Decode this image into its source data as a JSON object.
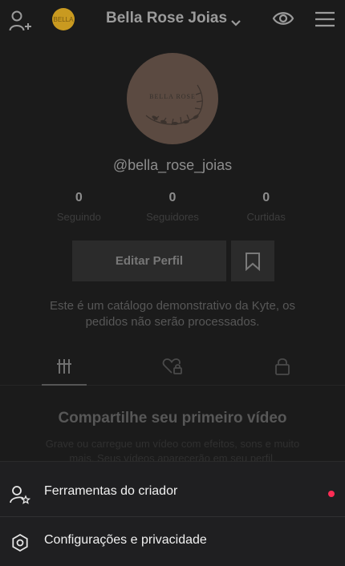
{
  "header": {
    "avatar_text": "BELLA",
    "title": "Bella Rose Joias"
  },
  "profile": {
    "photo_text": "BELLA ROSE",
    "username": "@bella_rose_joias",
    "stats": [
      {
        "value": "0",
        "label": "Seguindo"
      },
      {
        "value": "0",
        "label": "Seguidores"
      },
      {
        "value": "0",
        "label": "Curtidas"
      }
    ],
    "edit_label": "Editar Perfil",
    "notice": "Este é um catálogo demonstrativo da Kyte, os pedidos não serão processados."
  },
  "empty_state": {
    "title": "Compartilhe seu primeiro vídeo",
    "subtitle": "Grave ou carregue um vídeo com efeitos, sons e muito mais. Seus vídeos aparecerão em seu perfil."
  },
  "sheet": {
    "items": [
      {
        "label": "Ferramentas do criador",
        "icon": "creator-tools-icon",
        "has_notification": true
      },
      {
        "label": "Configurações e privacidade",
        "icon": "settings-icon",
        "has_notification": false
      }
    ]
  },
  "colors": {
    "background": "#1b1b1b",
    "sheet": "#1f1f21",
    "notification_dot": "#ff2d55",
    "avatar": "#c99a20"
  }
}
